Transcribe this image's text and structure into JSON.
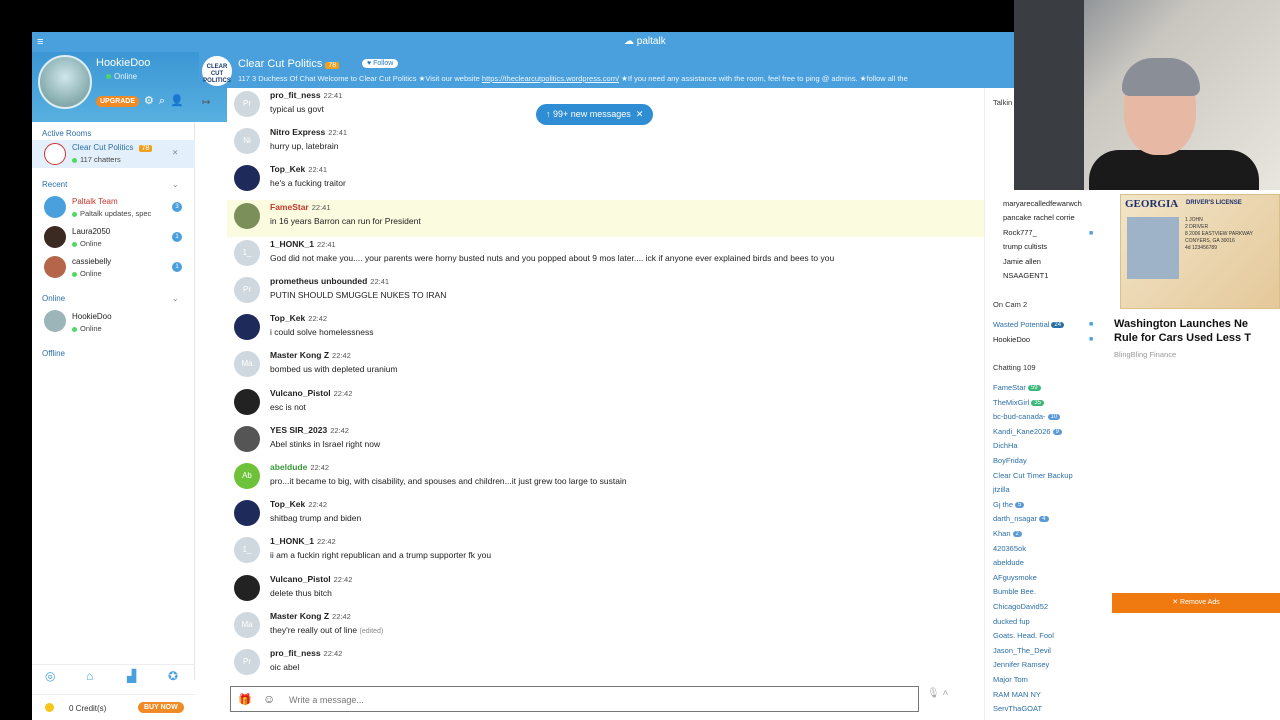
{
  "app": {
    "brand": "paltalk",
    "menu_icon": "hamburger-icon"
  },
  "profile": {
    "name": "HookieDoo",
    "status": "Online",
    "upgrade_label": "UPGRADE"
  },
  "room": {
    "logo_text": "CLEAR CUT POLITICS",
    "title": "Clear Cut Politics",
    "badge": "78",
    "follow_label": "Follow",
    "info_prefix": "117   3   Duchess Of Chat   Welcome to Clear Cut Politics ★Visit our website ",
    "info_link": "https://theclearcutpolitics.wordpress.com/",
    "info_suffix": " ★If you need any assistance with the room, feel free to ping @ admins. ★follow all the"
  },
  "sidebar": {
    "active_rooms_title": "Active Rooms",
    "active_room": {
      "name": "Clear Cut Politics",
      "badge": "78",
      "sub": "117 chatters"
    },
    "recent_title": "Recent",
    "recent": [
      {
        "name": "Paltalk Team",
        "sub": "Paltalk updates, spec",
        "count": "3"
      },
      {
        "name": "Laura2050",
        "sub": "Online",
        "count": "1"
      },
      {
        "name": "cassiebelly",
        "sub": "Online",
        "count": "1"
      }
    ],
    "online_title": "Online",
    "online": [
      {
        "name": "HookieDoo",
        "sub": "Online"
      }
    ],
    "offline_title": "Offline",
    "credits": "0 Credit(s)",
    "buy_label": "BUY NOW"
  },
  "new_messages": "99+ new messages",
  "messages": [
    {
      "initials": "Pr",
      "nick": "pro_fit_ness",
      "time": "22:41",
      "text": "typical us govt"
    },
    {
      "initials": "Ni",
      "nick": "Nitro Express",
      "time": "22:41",
      "text": "hurry up, latebrain"
    },
    {
      "initials": "",
      "nick": "Top_Kek",
      "time": "22:41",
      "text": "he's a fucking traitor"
    },
    {
      "initials": "",
      "nick": "FameStar",
      "time": "22:41",
      "text": "in 16 years Barron can run for President"
    },
    {
      "initials": "1_",
      "nick": "1_HONK_1",
      "time": "22:41",
      "text": "God did not make you.... your parents were horny busted nuts and you popped about 9 mos later.... ick if anyone ever explained birds and bees to you"
    },
    {
      "initials": "Pr",
      "nick": "prometheus unbounded",
      "time": "22:41",
      "text": "PUTIN SHOULD SMUGGLE NUKES TO IRAN"
    },
    {
      "initials": "",
      "nick": "Top_Kek",
      "time": "22:42",
      "text": "i could solve homelessness"
    },
    {
      "initials": "Ma",
      "nick": "Master Kong Z",
      "time": "22:42",
      "text": "bombed us with depleted uranium"
    },
    {
      "initials": "",
      "nick": "Vulcano_Pistol",
      "time": "22:42",
      "text": "esc is not"
    },
    {
      "initials": "",
      "nick": "YES SIR_2023",
      "time": "22:42",
      "text": "Abel stinks in Israel right now"
    },
    {
      "initials": "Ab",
      "nick": "abeldude",
      "time": "22:42",
      "text": "pro...it became to big, with cisability, and spouses and children...it just grew too large to sustain"
    },
    {
      "initials": "",
      "nick": "Top_Kek",
      "time": "22:42",
      "text": "shitbag trump and biden"
    },
    {
      "initials": "1_",
      "nick": "1_HONK_1",
      "time": "22:42",
      "text": "ii am a fuckin right republican and a trump supporter fk you"
    },
    {
      "initials": "",
      "nick": "Vulcano_Pistol",
      "time": "22:42",
      "text": "delete thus bitch"
    },
    {
      "initials": "Ma",
      "nick": "Master Kong Z",
      "time": "22:42",
      "text": "they're really out of line",
      "edited": "(edited)"
    },
    {
      "initials": "Pr",
      "nick": "pro_fit_ness",
      "time": "22:42",
      "text": "oic abel"
    }
  ],
  "composer": {
    "placeholder": "Write a message..."
  },
  "userlist": {
    "talking_title": "Talkin",
    "top_users": [
      "maryarecalledfewarwch",
      "pancake rachel corrie",
      "Rock777_",
      "trump cultists",
      "Jamie allen",
      "NSAAGENT1"
    ],
    "oncam_title": "On Cam  2",
    "oncam": [
      {
        "name": "Wasted Potential",
        "tag": "24"
      },
      {
        "name": "HookieDoo",
        "tag": ""
      }
    ],
    "chatting_title": "Chatting  109",
    "chatting": [
      {
        "name": "FameStar",
        "tag": "59"
      },
      {
        "name": "TheMixGirl",
        "tag": "35"
      },
      {
        "name": "bc-bud-canada-",
        "tag": "10"
      },
      {
        "name": "Kandi_Kane2026",
        "tag": "9"
      },
      {
        "name": "DichHa",
        "tag": ""
      },
      {
        "name": "BoyFriday",
        "tag": ""
      },
      {
        "name": "Clear Cut Timer Backup",
        "tag": ""
      },
      {
        "name": "jtzilla",
        "tag": ""
      },
      {
        "name": "Gj the",
        "tag": "5"
      },
      {
        "name": "darth_nsagar",
        "tag": "4"
      },
      {
        "name": "Khan",
        "tag": "2"
      },
      {
        "name": "420365ok",
        "tag": ""
      },
      {
        "name": "abeldude",
        "tag": ""
      },
      {
        "name": "AFguysmoke",
        "tag": ""
      },
      {
        "name": "Bumble Bee.",
        "tag": ""
      },
      {
        "name": "ChicagoDavid52",
        "tag": ""
      },
      {
        "name": "ducked fup",
        "tag": ""
      },
      {
        "name": "Goats. Head. Fool",
        "tag": ""
      },
      {
        "name": "Jason_The_Devil",
        "tag": ""
      },
      {
        "name": "Jennifer Ramsey",
        "tag": ""
      },
      {
        "name": "Major Tom",
        "tag": ""
      },
      {
        "name": "RAM MAN NY",
        "tag": ""
      },
      {
        "name": "ServThaGOAT",
        "tag": ""
      }
    ]
  },
  "ad": {
    "card_state": "GEORGIA",
    "card_type": "DRIVER'S LICENSE",
    "card_lines": "1 JOHN\n2 DRIVER\n8 2006 EASTVIEW PARKWAY\nCONYERS, GA 30016\n4d 123456789",
    "headline_1": "Washington Launches Ne",
    "headline_2": "Rule for Cars Used Less T",
    "source": "BlingBling Finance",
    "remove_label": "✕ Remove Ads"
  }
}
